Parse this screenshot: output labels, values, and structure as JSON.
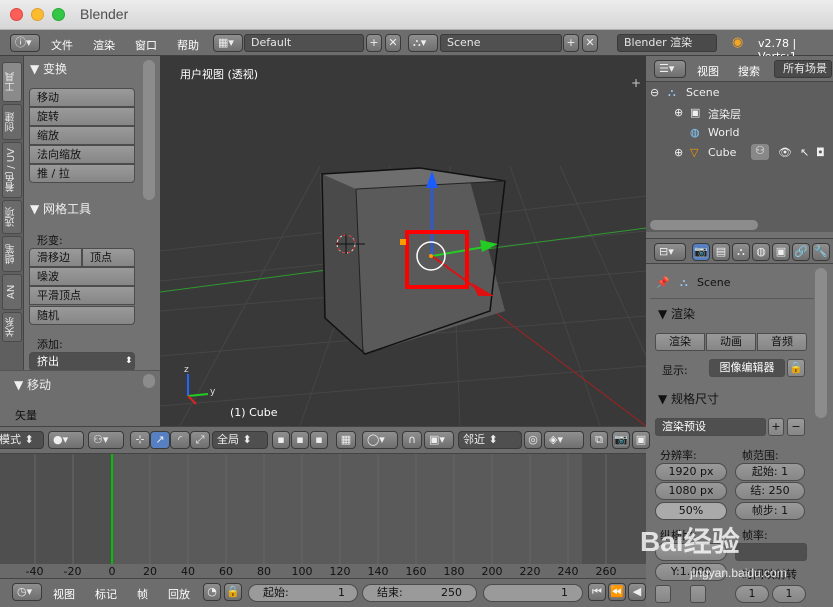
{
  "window": {
    "title": "Blender"
  },
  "topbar": {
    "menus": [
      "文件",
      "渲染",
      "窗口",
      "帮助"
    ],
    "screen_layout": "Default",
    "scene": "Scene",
    "render_engine": "Blender 渲染",
    "version": "v2.78 | Verts:1"
  },
  "tabs": [
    "工具",
    "创建",
    "关系",
    "着色 / UV",
    "选项",
    "蜡笔",
    "AN"
  ],
  "tools": {
    "transform_header": "▼ 变换",
    "transform_buttons": [
      "移动",
      "旋转",
      "缩放",
      "法向缩放",
      "推 / 拉"
    ],
    "mesh_header": "▼ 网格工具",
    "deform_label": "形变:",
    "slide_edge": "滑移边",
    "vertex": "顶点",
    "mesh_buttons": [
      "噪波",
      "平滑顶点",
      "随机"
    ],
    "add_label": "添加:",
    "extrude": "挤出",
    "move_header": "▼ 移动",
    "vector_label": "矢量"
  },
  "viewport": {
    "title": "用户视图 (透视)",
    "object_label": "(1) Cube"
  },
  "viewport_header": {
    "mode": "模式",
    "global": "全局",
    "proportional": "邻近"
  },
  "outliner": {
    "view": "视图",
    "search": "搜索",
    "all_scenes": "所有场景",
    "rows": [
      "Scene",
      "渲染层",
      "World",
      "Cube"
    ]
  },
  "properties": {
    "scene": "Scene",
    "render_section": "▼ 渲染",
    "render_btn": "渲染",
    "anim_btn": "动画",
    "audio_btn": "音频",
    "display_label": "显示:",
    "display_value": "图像编辑器",
    "dimensions_section": "▼ 规格尺寸",
    "render_preset": "渲染预设",
    "resolution_label": "分辨率:",
    "res_x": "1920 px",
    "res_y": "1080 px",
    "res_pct": "50%",
    "frame_range_label": "帧范围:",
    "start": "起始:",
    "start_val": "1",
    "end": "结:",
    "end_val": "250",
    "step": "帧步:",
    "step_val": "1",
    "aspect_label": "纵横比:",
    "frame_rate_label": "帧率:",
    "aspect_y": "Y:1.000",
    "time_remap": "时间映射转"
  },
  "timeline": {
    "numbers": [
      "-40",
      "-20",
      "0",
      "20",
      "40",
      "60",
      "80",
      "100",
      "120",
      "140",
      "160",
      "180",
      "200",
      "220",
      "240",
      "260"
    ]
  },
  "bottom": {
    "menus": [
      "视图",
      "标记",
      "帧",
      "回放"
    ],
    "start_label": "起始:",
    "start_value": "1",
    "end_label": "结束:",
    "end_value": "250",
    "current_value": "1"
  },
  "watermark": {
    "text": "Bai经验",
    "url": "jingyan.baidu.com"
  },
  "colors": {
    "accent": "#5680c2",
    "highlight": "#ff0000",
    "green": "#00c000"
  }
}
